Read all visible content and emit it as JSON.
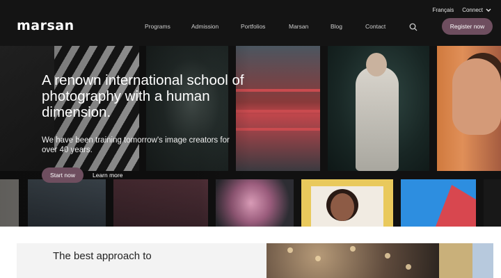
{
  "header": {
    "logo": "marsan",
    "lang": "Français",
    "connect": "Connect",
    "nav": [
      "Programs",
      "Admission",
      "Portfolios",
      "Marsan",
      "Blog",
      "Contact"
    ],
    "register": "Register now"
  },
  "hero": {
    "headline": "A renown international school of photography with a human dimension.",
    "subline": "We have been training tomorrow's image creators for over 40 years.",
    "start": "Start now",
    "learn": "Learn more"
  },
  "lower": {
    "title": "The best approach to"
  }
}
